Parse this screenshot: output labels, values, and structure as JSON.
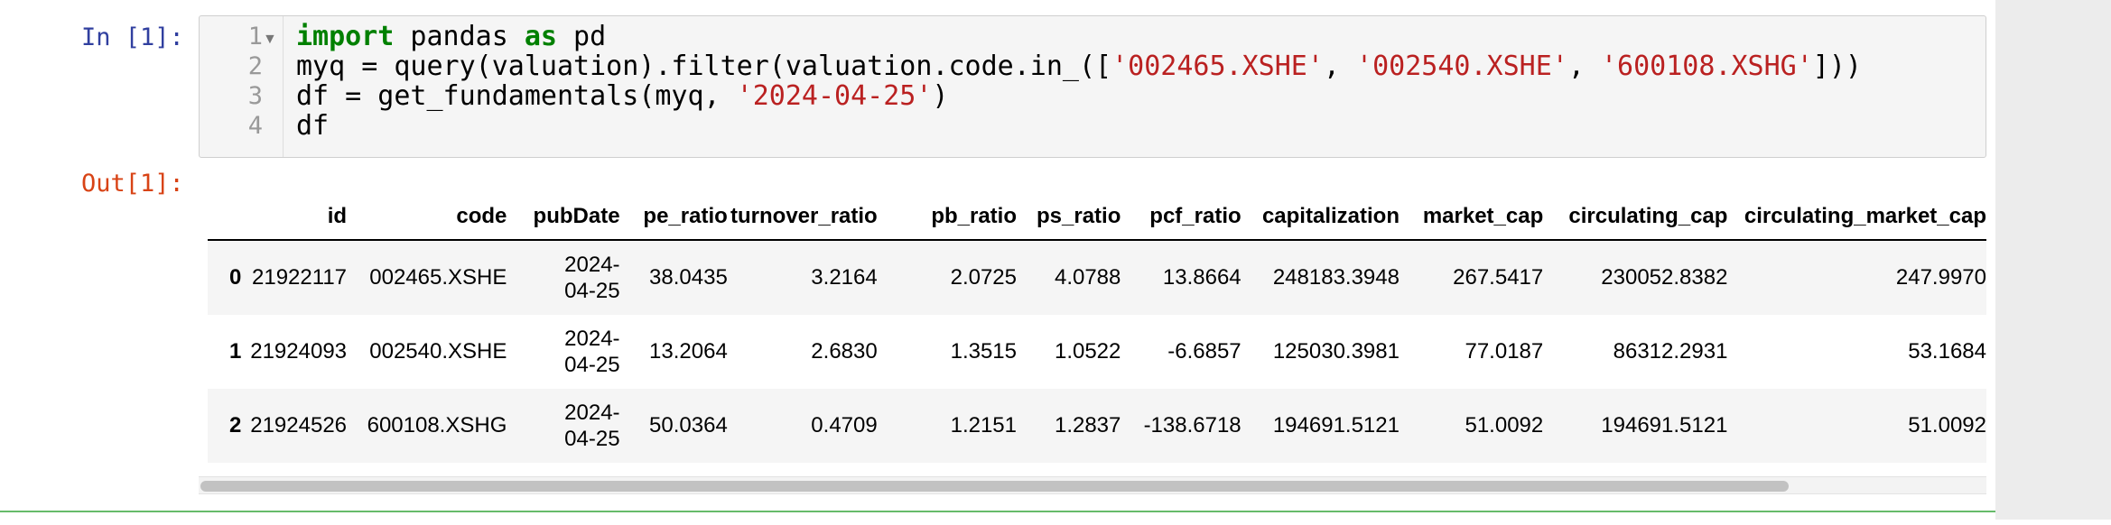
{
  "cells": {
    "in_prompt": "In [1]:",
    "out_prompt": "Out[1]:",
    "code": {
      "line_numbers": [
        "1",
        "2",
        "3",
        "4"
      ],
      "fold_marker": "▼",
      "line1": {
        "kw1": "import",
        "t1": " pandas ",
        "kw2": "as",
        "t2": " pd"
      },
      "line2": {
        "t1": "myq = query(valuation).filter(valuation.code.in_([",
        "s1": "'002465.XSHE'",
        "c1": ", ",
        "s2": "'002540.XSHE'",
        "c2": ", ",
        "s3": "'600108.XSHG'",
        "t2": "]))"
      },
      "line3": {
        "t1": "df = get_fundamentals(myq, ",
        "s1": "'2024-04-25'",
        "t2": ")"
      },
      "line4": {
        "t1": "df"
      }
    }
  },
  "dataframe": {
    "columns": [
      "",
      "id",
      "code",
      "pubDate",
      "pe_ratio",
      "turnover_ratio",
      "pb_ratio",
      "ps_ratio",
      "pcf_ratio",
      "capitalization",
      "market_cap",
      "circulating_cap",
      "circulating_market_cap"
    ],
    "rows": [
      {
        "index": "0",
        "id": "21922117",
        "code": "002465.XSHE",
        "date1": "2024-",
        "date2": "04-25",
        "pe_ratio": "38.0435",
        "turnover_ratio": "3.2164",
        "pb_ratio": "2.0725",
        "ps_ratio": "4.0788",
        "pcf_ratio": "13.8664",
        "capitalization": "248183.3948",
        "market_cap": "267.5417",
        "circulating_cap": "230052.8382",
        "circulating_market_cap": "247.9970"
      },
      {
        "index": "1",
        "id": "21924093",
        "code": "002540.XSHE",
        "date1": "2024-",
        "date2": "04-25",
        "pe_ratio": "13.2064",
        "turnover_ratio": "2.6830",
        "pb_ratio": "1.3515",
        "ps_ratio": "1.0522",
        "pcf_ratio": "-6.6857",
        "capitalization": "125030.3981",
        "market_cap": "77.0187",
        "circulating_cap": "86312.2931",
        "circulating_market_cap": "53.1684"
      },
      {
        "index": "2",
        "id": "21924526",
        "code": "600108.XSHG",
        "date1": "2024-",
        "date2": "04-25",
        "pe_ratio": "50.0364",
        "turnover_ratio": "0.4709",
        "pb_ratio": "1.2151",
        "ps_ratio": "1.2837",
        "pcf_ratio": "-138.6718",
        "capitalization": "194691.5121",
        "market_cap": "51.0092",
        "circulating_cap": "194691.5121",
        "circulating_market_cap": "51.0092"
      }
    ]
  },
  "scrollbar": {
    "thumb_fraction": 0.89
  },
  "colors": {
    "in_prompt": "#303f9f",
    "out_prompt": "#d84315",
    "keyword": "#008000",
    "string": "#ba2121",
    "active_cell_border": "#66bb6a"
  }
}
